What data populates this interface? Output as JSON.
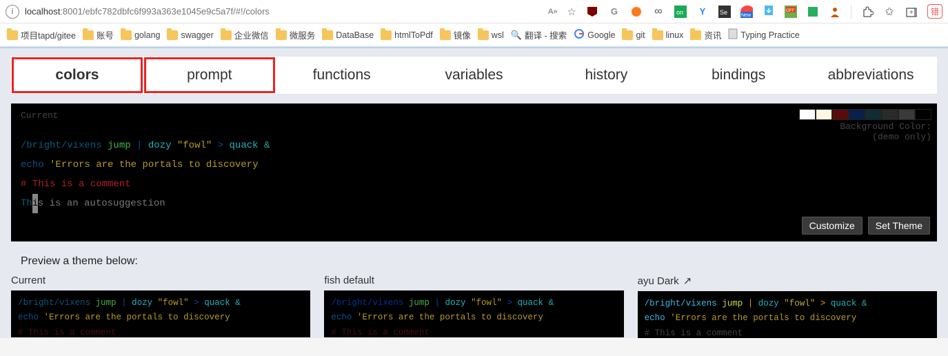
{
  "addr": {
    "host": "localhost",
    "rest": ":8001/ebfc782dbfc6f993a363e1045e9c5a7f/#!/colors",
    "read_aloud": "A»",
    "fav": "☆",
    "err_label": "错"
  },
  "ext_icons": [
    "ublock",
    "g",
    "orange",
    "infinity",
    "youdao",
    "y",
    "se",
    "new",
    "dl",
    "off",
    "green",
    "avatar",
    "puzzle",
    "star",
    "collections"
  ],
  "bookmarks": [
    {
      "label": "项目tapd/gitee",
      "icon": "folder"
    },
    {
      "label": "账号",
      "icon": "folder"
    },
    {
      "label": "golang",
      "icon": "folder"
    },
    {
      "label": "swagger",
      "icon": "folder"
    },
    {
      "label": "企业微信",
      "icon": "folder"
    },
    {
      "label": "微服务",
      "icon": "folder"
    },
    {
      "label": "DataBase",
      "icon": "folder"
    },
    {
      "label": "htmlToPdf",
      "icon": "folder"
    },
    {
      "label": "镜像",
      "icon": "folder"
    },
    {
      "label": "wsl",
      "icon": "folder"
    },
    {
      "label": "翻译 - 搜索",
      "icon": "search"
    },
    {
      "label": "Google",
      "icon": "google"
    },
    {
      "label": "git",
      "icon": "folder"
    },
    {
      "label": "linux",
      "icon": "folder"
    },
    {
      "label": "资讯",
      "icon": "folder"
    },
    {
      "label": "Typing Practice",
      "icon": "page"
    }
  ],
  "tabs": [
    "colors",
    "prompt",
    "functions",
    "variables",
    "history",
    "bindings",
    "abbreviations"
  ],
  "terminal": {
    "current_label": "Current",
    "bgcolor_label": "Background Color:",
    "bgcolor_sub": "(demo only)",
    "swatches": [
      "#ffffff",
      "#fdf6e3",
      "#5a0b0b",
      "#0b1f4b",
      "#0f2d33",
      "#2a2a2a",
      "#3a3a3a",
      "#000000"
    ],
    "line1": {
      "path": "/bright/vixens",
      "cmd": "jump",
      "pipe": "|",
      "arg": "dozy",
      "str": "\"fowl\"",
      "redir": ">",
      "tgt": "quack",
      "amp": "&"
    },
    "line2": {
      "echo": "echo",
      "str": "'Errors are the portals to discovery"
    },
    "line3": {
      "comment": "# This is a comment"
    },
    "line4": {
      "th": "Th",
      "cursor": "i",
      "rest": "s is an autosuggestion"
    },
    "buttons": {
      "customize": "Customize",
      "set_theme": "Set Theme"
    }
  },
  "preview_label": "Preview a theme below:",
  "themes": [
    {
      "title": "Current",
      "l1": {
        "path": "/bright/vixens",
        "cmd": "jump",
        "pipe": "|",
        "arg": "dozy",
        "str": "\"fowl\"",
        "redir": ">",
        "tgt": "quack",
        "amp": "&"
      },
      "l2": {
        "echo": "echo",
        "str": "'Errors are the portals to discovery"
      },
      "l3": {
        "comment": "# This is a comment"
      }
    },
    {
      "title": "fish default",
      "l1": {
        "path": "/bright/vixens",
        "cmd": "jump",
        "pipe": "|",
        "arg": "dozy",
        "str": "\"fowl\"",
        "redir": ">",
        "tgt": "quack",
        "amp": "&"
      },
      "l2": {
        "echo": "echo",
        "str": "'Errors are the portals to discovery"
      },
      "l3": {
        "comment": "# This is a comment"
      }
    },
    {
      "title": "ayu Dark",
      "ext": true,
      "l1": {
        "path": "/bright/vixens",
        "cmd": "jump",
        "pipe": "|",
        "arg": "dozy",
        "str": "\"fowl\"",
        "redir": ">",
        "tgt": "quack",
        "amp": "&"
      },
      "l2": {
        "echo": "echo",
        "str": "'Errors are the portals to discovery"
      },
      "l3": {
        "comment": "# This is a comment"
      }
    }
  ]
}
